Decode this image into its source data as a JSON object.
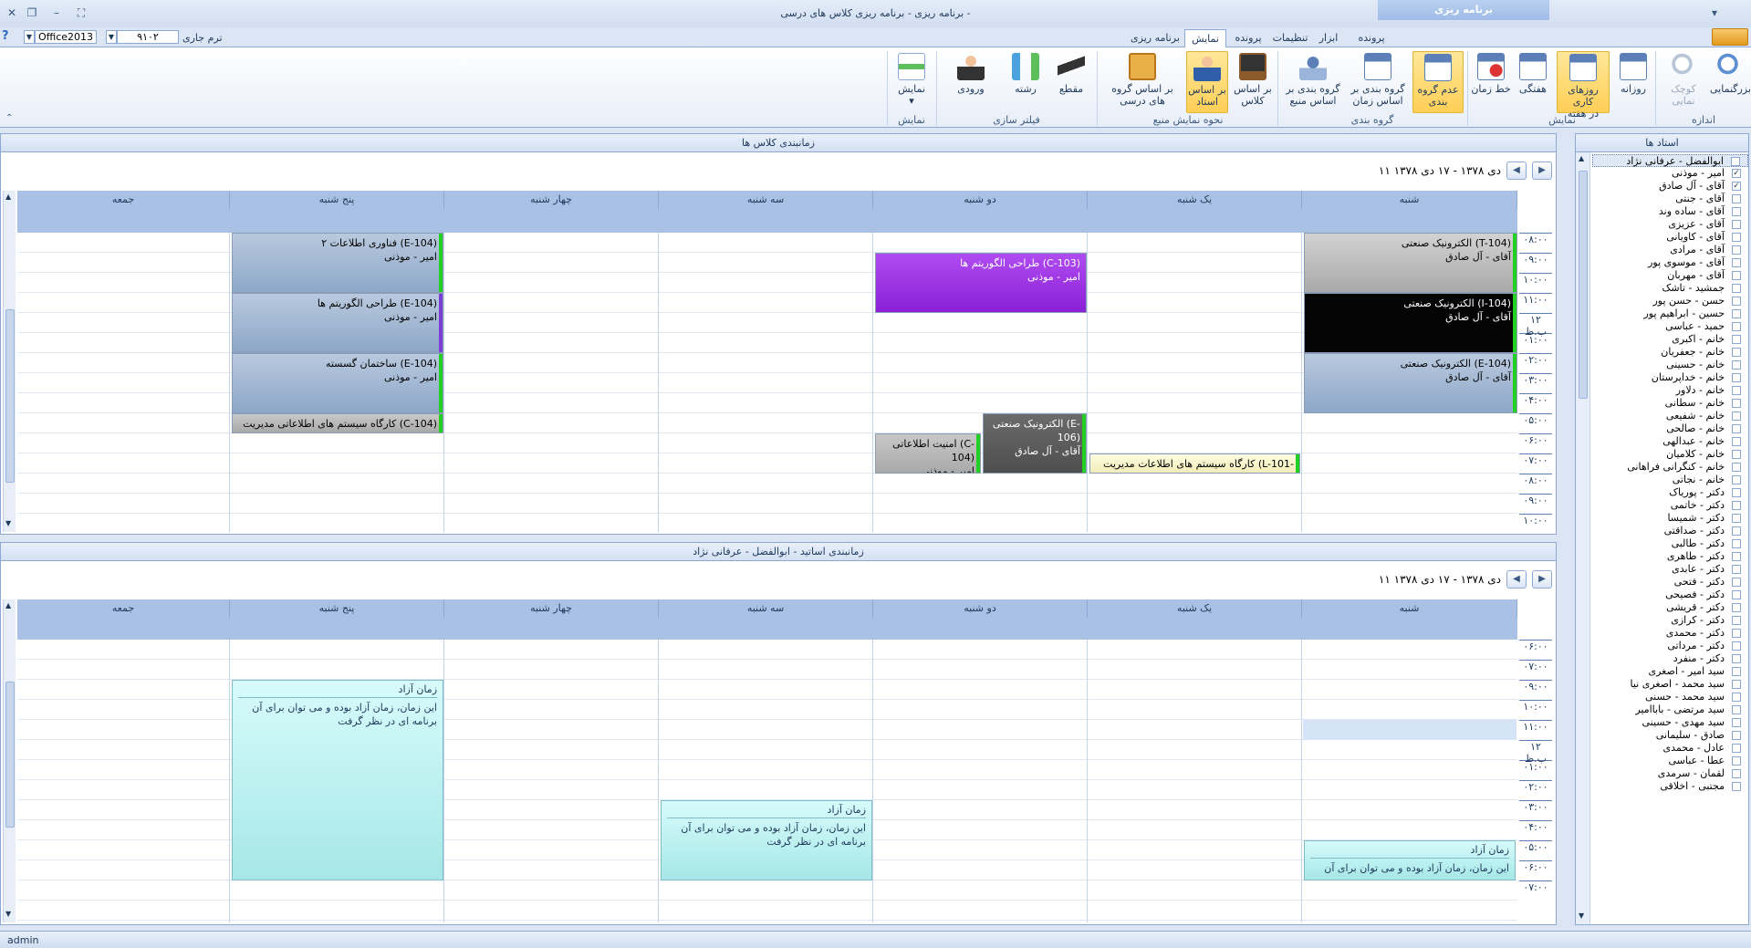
{
  "window": {
    "title": "برنامه ریزی - برنامه ریزی کلاس های درسی -",
    "context_tab": "برنامه ریزی"
  },
  "quickbar": {
    "term_label": "ترم جاری",
    "term_value": "۹۱۰۲",
    "theme_value": "Office2013",
    "help": "?"
  },
  "tabs": {
    "file": "",
    "file_tab": "پرونده",
    "tools": "ابزار",
    "settings": "تنظیمات",
    "file2": "پرونده",
    "view": "نمایش",
    "schedule": "برنامه ریزی"
  },
  "ribbon": {
    "zoom_in": "بزرگنمایی",
    "zoom_out": "کوچک نمایی",
    "group_size": "اندازه",
    "daily": "روزانه",
    "work_days_1": "روزهای کاری",
    "work_days_2": "در هفته",
    "weekly": "هفتگی",
    "timeline": "خط زمان",
    "group_view": "نمایش",
    "no_group_1": "عدم گروه",
    "no_group_2": "بندی",
    "group_time_1": "گروه بندی بر",
    "group_time_2": "اساس زمان",
    "group_res_1": "گروه بندی بر",
    "group_res_2": "اساس منبع",
    "group_grouping": "گروه بندی",
    "by_class_1": "بر اساس",
    "by_class_2": "کلاس",
    "by_teacher_1": "بر اساس",
    "by_teacher_2": "استاد",
    "by_cgroup_1": "بر اساس گروه",
    "by_cgroup_2": "های درسی",
    "group_resource": "نحوه  نمایش منبع",
    "section": "مقطع",
    "field": "رشته",
    "entry": "ورودی",
    "group_filter": "فیلتر سازی",
    "show": "نمایش",
    "group_show": "نمایش"
  },
  "top_panel": {
    "header": "زمانبندی کلاس ها",
    "range": "۱۱ دی ۱۳۷۸ - ۱۷ دی ۱۳۷۸",
    "days": [
      "شنبه",
      "یک شنبه",
      "دو شنبه",
      "سه شنبه",
      "چهار شنبه",
      "پنج شنبه",
      "جمعه"
    ],
    "times": [
      "۰۸:۰۰",
      "۰۹:۰۰",
      "۱۰:۰۰",
      "۱۱:۰۰",
      "۱۲ ب.ظ",
      "۰۱:۰۰",
      "۰۲:۰۰",
      "۰۳:۰۰",
      "۰۴:۰۰",
      "۰۵:۰۰",
      "۰۶:۰۰",
      "۰۷:۰۰",
      "۰۸:۰۰",
      "۰۹:۰۰",
      "۱۰:۰۰"
    ],
    "appointments": {
      "sat1": {
        "title": "الکترونیک صنعتی (T-104)",
        "who": "آقای - آل صادق"
      },
      "sat2": {
        "title": "الکترونیک صنعتی (I-104)",
        "who": "آقای - آل صادق"
      },
      "sat3": {
        "title": "الکترونیک صنعتی (E-104)",
        "who": "آقای - آل صادق"
      },
      "sun1": {
        "title": "کارگاه سیستم های اطلاعات مدیریت (L-101-E)",
        "who": ""
      },
      "mon1": {
        "title": "طراحی الگوریتم ها (C-103)",
        "who": "امیر - موذنی"
      },
      "mon2": {
        "title": "الکترونیک صنعتی (E-106)",
        "who": "آقای - آل صادق"
      },
      "mon3": {
        "title": "امنیت اطلاعاتی (C-104)",
        "who": "امیر - موذنی"
      },
      "thu1": {
        "title": "فناوری اطلاعات ۲ (E-104)",
        "who": "امیر - موذنی"
      },
      "thu2": {
        "title": "طراحی الگوریتم ها (E-104)",
        "who": "امیر - موذنی"
      },
      "thu3": {
        "title": "ساختمان گسسته (E-104)",
        "who": "امیر - موذنی"
      },
      "thu4": {
        "title": "کارگاه سیستم های اطلاعاتی مدیریت (C-104)",
        "who": ""
      }
    }
  },
  "bottom_panel": {
    "header": "زمانبندی اساتید - ابوالفضل - عرفانی نژاد",
    "range": "۱۱ دی ۱۳۷۸ - ۱۷ دی ۱۳۷۸",
    "times": [
      "۰۶:۰۰",
      "۰۷:۰۰",
      "۰۹:۰۰",
      "۱۰:۰۰",
      "۱۱:۰۰",
      "۱۲ ب.ظ",
      "۰۱:۰۰",
      "۰۲:۰۰",
      "۰۳:۰۰",
      "۰۴:۰۰",
      "۰۵:۰۰",
      "۰۶:۰۰",
      "۰۷:۰۰"
    ],
    "free": {
      "title": "زمان آزاد",
      "text_long": "این زمان، زمان آزاد بوده و می توان برای آن برنامه ای در نظر گرفت",
      "text_short": "این زمان، زمان آزاد بوده و می توان برای آن"
    }
  },
  "teachers": {
    "header": "استاد ها",
    "items": [
      {
        "name": "ابوالفضل - عرفانی نژاد",
        "checked": ""
      },
      {
        "name": "امیر - موذنی",
        "checked": "✓"
      },
      {
        "name": "آقای - آل صادق",
        "checked": "✓"
      },
      {
        "name": "آقای - جنتی",
        "checked": ""
      },
      {
        "name": "آقای - ساده وند",
        "checked": ""
      },
      {
        "name": "آقای - عزیزی",
        "checked": ""
      },
      {
        "name": "آقای - کاویانی",
        "checked": ""
      },
      {
        "name": "آقای - مرادی",
        "checked": ""
      },
      {
        "name": "آقای - موسوی پور",
        "checked": ""
      },
      {
        "name": "آقای - مهربان",
        "checked": ""
      },
      {
        "name": "جمشید - تاشک",
        "checked": ""
      },
      {
        "name": "حسن - حسن پور",
        "checked": ""
      },
      {
        "name": "حسین - ابراهیم پور",
        "checked": ""
      },
      {
        "name": "حمید - عباسی",
        "checked": ""
      },
      {
        "name": "خانم - اکبری",
        "checked": ""
      },
      {
        "name": "خانم - جعفریان",
        "checked": ""
      },
      {
        "name": "خانم - حسینی",
        "checked": ""
      },
      {
        "name": "خانم - خداپرستان",
        "checked": ""
      },
      {
        "name": "خانم - دلاور",
        "checked": ""
      },
      {
        "name": "خانم - سطانی",
        "checked": ""
      },
      {
        "name": "خانم - شفیعی",
        "checked": ""
      },
      {
        "name": "خانم - صالحی",
        "checked": ""
      },
      {
        "name": "خانم - عبدالهی",
        "checked": ""
      },
      {
        "name": "خانم - کلامیان",
        "checked": ""
      },
      {
        "name": "خانم - کنگرانی فراهانی",
        "checked": ""
      },
      {
        "name": "خانم - نجاتی",
        "checked": ""
      },
      {
        "name": "دکتر - پوریاک",
        "checked": ""
      },
      {
        "name": "دکتر - خاتمی",
        "checked": ""
      },
      {
        "name": "دکتر - شمیسا",
        "checked": ""
      },
      {
        "name": "دکتر - صداقتی",
        "checked": ""
      },
      {
        "name": "دکتر - طالبی",
        "checked": ""
      },
      {
        "name": "دکتر - طاهری",
        "checked": ""
      },
      {
        "name": "دکتر - عابدی",
        "checked": ""
      },
      {
        "name": "دکتر - فتحی",
        "checked": ""
      },
      {
        "name": "دکتر - فصیحی",
        "checked": ""
      },
      {
        "name": "دکتر - قریشی",
        "checked": ""
      },
      {
        "name": "دکتر - کرازی",
        "checked": ""
      },
      {
        "name": "دکتر - محمدی",
        "checked": ""
      },
      {
        "name": "دکتر - مرداتی",
        "checked": ""
      },
      {
        "name": "دکتر - منفرد",
        "checked": ""
      },
      {
        "name": "سید امیر - اصغری",
        "checked": ""
      },
      {
        "name": "سید محمد - اصغری نیا",
        "checked": ""
      },
      {
        "name": "سید محمد - حسنی",
        "checked": ""
      },
      {
        "name": "سید مرتضی - باباامیر",
        "checked": ""
      },
      {
        "name": "سید مهدی - حسینی",
        "checked": ""
      },
      {
        "name": "صادق - سلیمانی",
        "checked": ""
      },
      {
        "name": "عادل - محمدی",
        "checked": ""
      },
      {
        "name": "عطا - عباسی",
        "checked": ""
      },
      {
        "name": "لقمان - سرمدی",
        "checked": ""
      },
      {
        "name": "مجتبی - اخلاقی",
        "checked": ""
      }
    ]
  },
  "status": {
    "user": "admin"
  },
  "colors": {
    "accent": "#8ba9d4",
    "day_header": "#a9c1e4",
    "current_bar": "#22d022",
    "purple": "#9a2be0"
  }
}
